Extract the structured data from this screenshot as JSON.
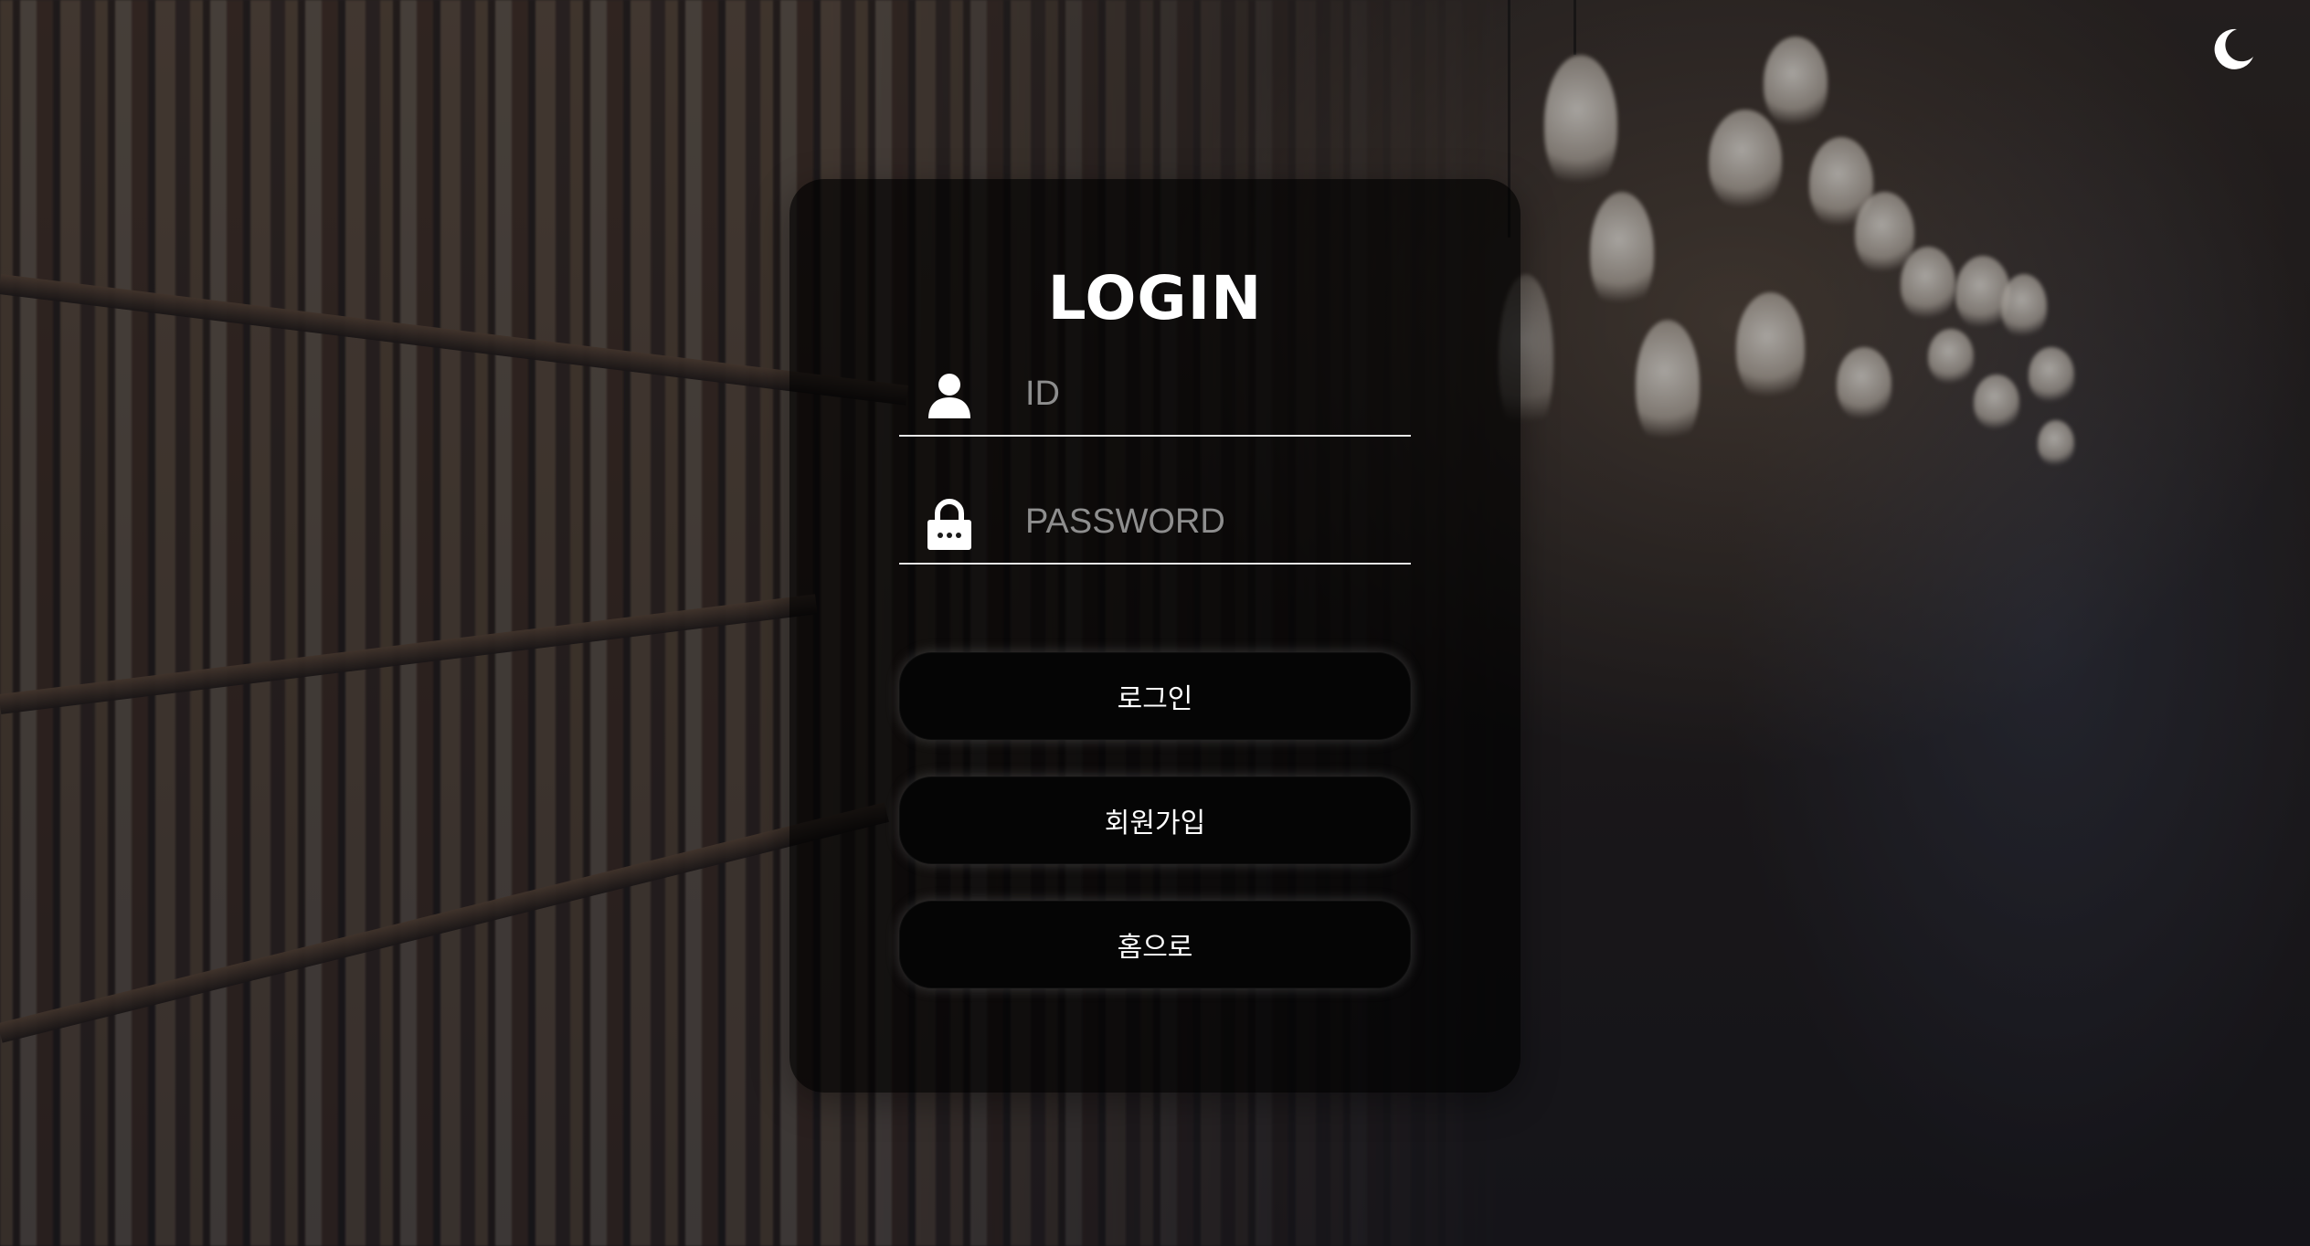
{
  "theme_toggle": {
    "icon": "moon-icon"
  },
  "login": {
    "title": "LOGIN",
    "id_field": {
      "icon": "user-icon",
      "placeholder": "ID",
      "value": ""
    },
    "password_field": {
      "icon": "lock-icon",
      "placeholder": "PASSWORD",
      "value": ""
    },
    "buttons": {
      "login_label": "로그인",
      "signup_label": "회원가입",
      "home_label": "홈으로"
    }
  },
  "colors": {
    "panel_background": "#000000",
    "text": "#ffffff",
    "placeholder": "#8e8e8e",
    "underline": "#e8e8e8",
    "button_background": "#050505"
  }
}
